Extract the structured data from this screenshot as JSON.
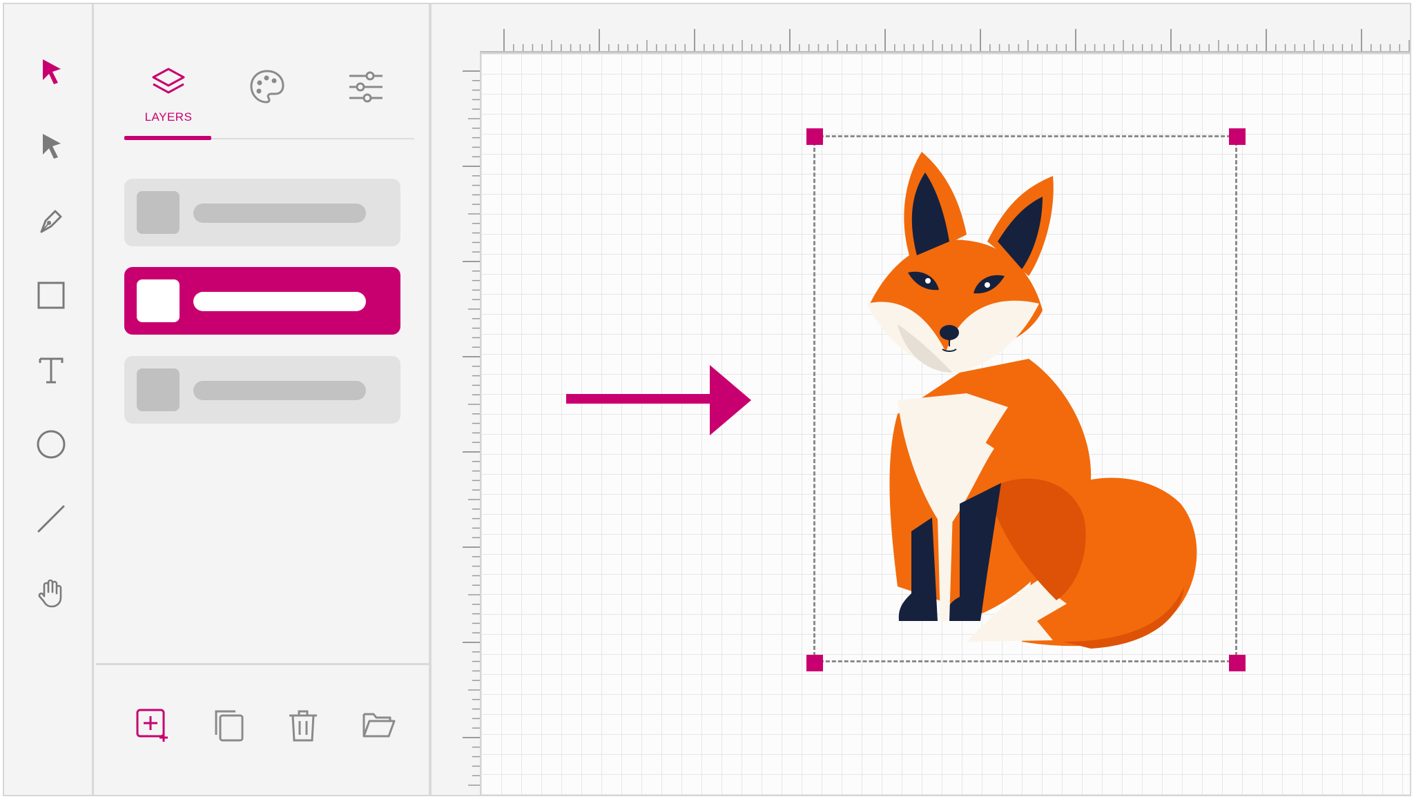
{
  "app": {
    "accent_color": "#c8006f"
  },
  "tools": [
    {
      "name": "select-tool",
      "icon": "cursor-arrow-icon",
      "active": true
    },
    {
      "name": "direct-select-tool",
      "icon": "direct-select-arrow-icon",
      "active": false
    },
    {
      "name": "pen-tool",
      "icon": "pen-nib-icon",
      "active": false
    },
    {
      "name": "rectangle-tool",
      "icon": "rectangle-icon",
      "active": false
    },
    {
      "name": "text-tool",
      "icon": "text-t-icon",
      "active": false
    },
    {
      "name": "ellipse-tool",
      "icon": "circle-icon",
      "active": false
    },
    {
      "name": "line-tool",
      "icon": "line-icon",
      "active": false
    },
    {
      "name": "hand-tool",
      "icon": "hand-icon",
      "active": false
    }
  ],
  "panel": {
    "tabs": [
      {
        "label": "LAYERS",
        "icon": "layers-icon",
        "active": true
      },
      {
        "label": "",
        "icon": "palette-icon",
        "active": false
      },
      {
        "label": "",
        "icon": "sliders-icon",
        "active": false
      }
    ],
    "layers": [
      {
        "selected": false
      },
      {
        "selected": true
      },
      {
        "selected": false
      }
    ],
    "footer_actions": [
      {
        "icon": "add-layer-icon"
      },
      {
        "icon": "duplicate-icon"
      },
      {
        "icon": "trash-icon"
      },
      {
        "icon": "folder-icon"
      }
    ]
  },
  "canvas": {
    "object": "fox-illustration-icon",
    "selection_color": "#c8006f",
    "fox_colors": {
      "orange": "#f26a0c",
      "dark_orange": "#dd5206",
      "navy": "#16213d",
      "cream": "#fbf4ea"
    }
  }
}
